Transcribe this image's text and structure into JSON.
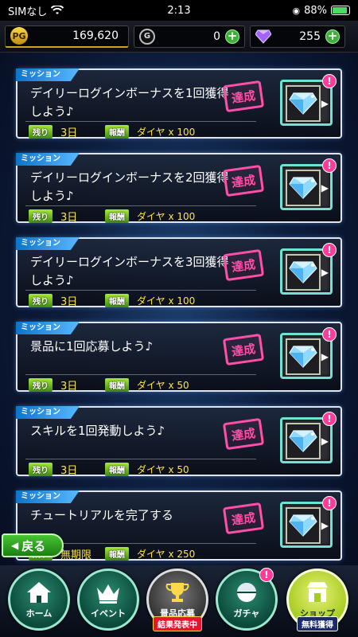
{
  "status": {
    "carrier": "SIMなし",
    "time": "2:13",
    "battery_pct": "88%",
    "battery_level": 0.88
  },
  "currency": {
    "pg_label": "PG",
    "pg_value": "169,620",
    "g_label": "G",
    "g_value": "0",
    "diamond_value": "255",
    "plus_glyph": "+"
  },
  "mission_tag": "ミッション",
  "labels": {
    "remaining": "残り",
    "reward": "報酬",
    "achieved": "達成",
    "notif": "!"
  },
  "missions": [
    {
      "text": "デイリーログインボーナスを1回獲得しよう♪",
      "remaining": "3日",
      "reward": "ダイヤ x 100"
    },
    {
      "text": "デイリーログインボーナスを2回獲得しよう♪",
      "remaining": "3日",
      "reward": "ダイヤ x 100"
    },
    {
      "text": "デイリーログインボーナスを3回獲得しよう♪",
      "remaining": "3日",
      "reward": "ダイヤ x 100"
    },
    {
      "text": "景品に1回応募しよう♪",
      "remaining": "3日",
      "reward": "ダイヤ x 50"
    },
    {
      "text": "スキルを1回発動しよう♪",
      "remaining": "3日",
      "reward": "ダイヤ x 50"
    },
    {
      "text": "チュートリアルを完了する",
      "remaining": "無期限",
      "reward": "ダイヤ x 250"
    }
  ],
  "back_label": "戻る",
  "nav": {
    "home": "ホーム",
    "event": "イベント",
    "prize": "景品応募",
    "prize_sub": "結果発表中",
    "gacha": "ガチャ",
    "shop": "ショップ",
    "shop_sub": "無料獲得"
  },
  "colors": {
    "accent_green": "#3fb13b",
    "stamp_pink": "#ff4fa8",
    "reward_yellow": "#ffe44a",
    "tag_blue": "#0d74c8"
  }
}
